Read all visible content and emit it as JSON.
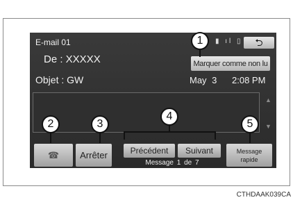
{
  "screen": {
    "title": "E-mail 01",
    "from": "De : XXXXX",
    "subject": "Objet : GW",
    "date": "May 3",
    "time": "2:08 PM",
    "mark_unread_label": "Marquer comme non lu",
    "back_glyph": "⮌",
    "status_glyphs": "▮ ıl ▯"
  },
  "buttons": {
    "phone_glyph": "☎",
    "stop_label": "Arrêter",
    "prev_label": "Précédent",
    "next_label": "Suivant",
    "counter": "Message 1 de 7",
    "quick_line1": "Message",
    "quick_line2": "rapide"
  },
  "callouts": [
    "1",
    "2",
    "3",
    "4",
    "5"
  ],
  "caption": "CTHDAAK039CA",
  "colors": {
    "screen_bg": "#2f2f2f",
    "button_light": "#d9d9d9",
    "button_dark": "#9f9f9f"
  }
}
